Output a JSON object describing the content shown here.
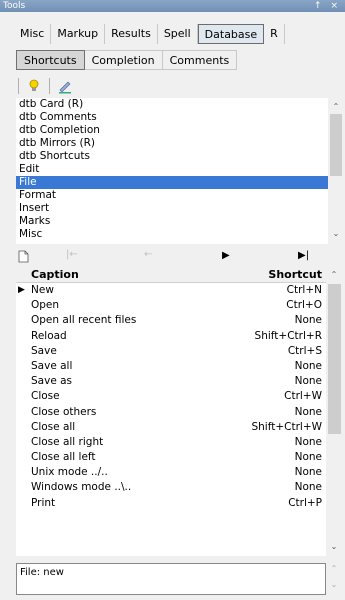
{
  "window": {
    "title": "Tools",
    "controls": "↑ ×"
  },
  "main_tabs": [
    {
      "label": "Misc",
      "active": false
    },
    {
      "label": "Markup",
      "active": false
    },
    {
      "label": "Results",
      "active": false
    },
    {
      "label": "Spell",
      "active": false
    },
    {
      "label": "Database",
      "active": true
    },
    {
      "label": "R",
      "active": false
    }
  ],
  "sub_tabs": [
    {
      "label": "Shortcuts",
      "active": true
    },
    {
      "label": "Completion",
      "active": false
    },
    {
      "label": "Comments",
      "active": false
    }
  ],
  "toolbar_icons": [
    "lightbulb-icon",
    "pen-icon"
  ],
  "categories": {
    "items": [
      "dtb Card (R)",
      "dtb Comments",
      "dtb Completion",
      "dtb Mirrors (R)",
      "dtb Shortcuts",
      "Edit",
      "File",
      "Format",
      "Insert",
      "Marks",
      "Misc"
    ],
    "selected": "File"
  },
  "nav_icons": [
    "new-doc-icon",
    "first-icon",
    "prev-icon",
    "play-icon",
    "last-icon"
  ],
  "grid": {
    "header": {
      "caption": "Caption",
      "shortcut": "Shortcut"
    },
    "current_row": "New",
    "rows": [
      {
        "caption": "New",
        "shortcut": "Ctrl+N"
      },
      {
        "caption": "Open",
        "shortcut": "Ctrl+O"
      },
      {
        "caption": "Open all recent files",
        "shortcut": "None"
      },
      {
        "caption": "Reload",
        "shortcut": "Shift+Ctrl+R"
      },
      {
        "caption": "Save",
        "shortcut": "Ctrl+S"
      },
      {
        "caption": "Save all",
        "shortcut": "None"
      },
      {
        "caption": "Save as",
        "shortcut": "None"
      },
      {
        "caption": "Close",
        "shortcut": "Ctrl+W"
      },
      {
        "caption": "Close others",
        "shortcut": "None"
      },
      {
        "caption": "Close all",
        "shortcut": "Shift+Ctrl+W"
      },
      {
        "caption": "Close all right",
        "shortcut": "None"
      },
      {
        "caption": "Close all left",
        "shortcut": "None"
      },
      {
        "caption": "Unix mode ../..",
        "shortcut": "None"
      },
      {
        "caption": "Windows mode ..\\..",
        "shortcut": "None"
      },
      {
        "caption": "Print",
        "shortcut": "Ctrl+P"
      }
    ]
  },
  "status": "File: new",
  "colors": {
    "selection": "#3a78d6",
    "active_tab": "#dfe7f1"
  }
}
